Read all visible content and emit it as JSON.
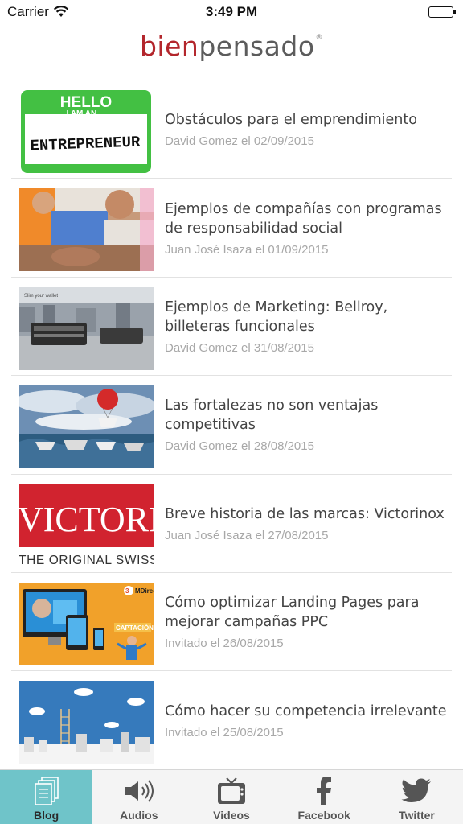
{
  "status_bar": {
    "carrier": "Carrier",
    "time": "3:49 PM",
    "wifi_icon": "wifi-icon",
    "battery_icon": "battery-icon"
  },
  "header": {
    "logo_part1": "bien",
    "logo_part2": "pensado",
    "logo_mark": "®",
    "brand_red": "#b3262c",
    "brand_gray": "#5c5c5c"
  },
  "articles": [
    {
      "title": "Obstáculos para el emprendimiento",
      "meta": "David Gomez el 02/09/2015",
      "thumb_text_1": "HELLO",
      "thumb_text_2": "I AM AN ...",
      "thumb_text_3": "ENTREPRENEUR"
    },
    {
      "title": "Ejemplos de compañías con programas de responsabilidad social",
      "meta": "Juan José Isaza el 01/09/2015"
    },
    {
      "title": "Ejemplos de Marketing: Bellroy, billeteras funcionales",
      "meta": "David Gomez el 31/08/2015",
      "thumb_text_1": "Slim your wallet"
    },
    {
      "title": "Las fortalezas no son ventajas competitivas",
      "meta": "David Gomez el 28/08/2015"
    },
    {
      "title": "Breve historia de las marcas: Victorinox",
      "meta": "Juan José Isaza el 27/08/2015",
      "thumb_text_1": "VICTORI",
      "thumb_text_2": "THE ORIGINAL SWISS"
    },
    {
      "title": "Cómo optimizar Landing Pages para mejorar campañas PPC",
      "meta": "Invitado el 26/08/2015",
      "thumb_text_1": "CAPTACIÓN",
      "thumb_text_2": "MDirecto"
    },
    {
      "title": "Cómo hacer su competencia irrelevante",
      "meta": "Invitado el 25/08/2015"
    }
  ],
  "tabs": [
    {
      "label": "Blog",
      "icon": "blog-pages-icon",
      "active": true
    },
    {
      "label": "Audios",
      "icon": "speaker-icon",
      "active": false
    },
    {
      "label": "Videos",
      "icon": "tv-icon",
      "active": false
    },
    {
      "label": "Facebook",
      "icon": "facebook-icon",
      "active": false
    },
    {
      "label": "Twitter",
      "icon": "twitter-bird-icon",
      "active": false
    }
  ],
  "colors": {
    "tab_active": "#6fc4c9",
    "tab_bar_bg": "#f4f4f4",
    "meta_text": "#a8a8a8",
    "title_text": "#444444"
  }
}
